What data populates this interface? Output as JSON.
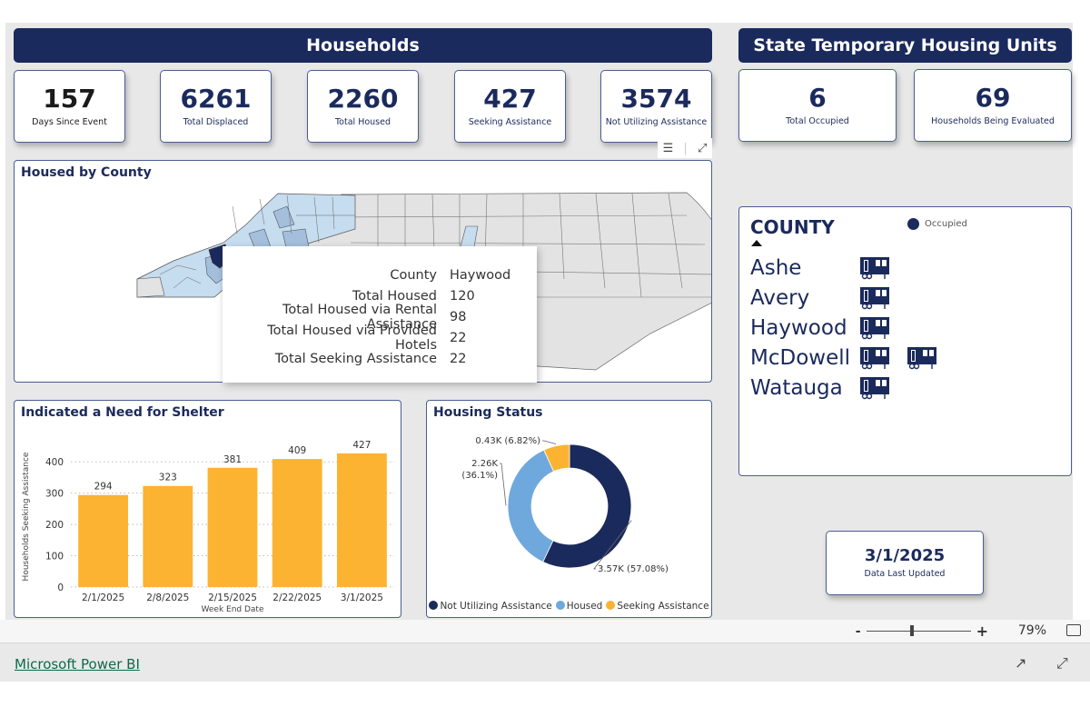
{
  "banners": {
    "households": "Households",
    "temp_housing": "State Temporary Housing Units"
  },
  "kpis": [
    {
      "value": "157",
      "label": "Days Since Event"
    },
    {
      "value": "6261",
      "label": "Total Displaced"
    },
    {
      "value": "2260",
      "label": "Total Housed"
    },
    {
      "value": "427",
      "label": "Seeking Assistance"
    },
    {
      "value": "3574",
      "label": "Not Utilizing Assistance"
    }
  ],
  "temp_kpis": [
    {
      "value": "6",
      "label": "Total Occupied"
    },
    {
      "value": "69",
      "label": "Households Being Evaluated"
    }
  ],
  "visual_toolbar": {
    "filter_icon": "filter-icon",
    "focus_icon": "focus-mode-icon"
  },
  "map": {
    "title": "Housed by County",
    "colors": {
      "none": "#e3e3e3",
      "low": "#c6dcef",
      "mid": "#a3bfdc",
      "high": "#1b2a5c"
    },
    "tooltip": [
      {
        "key": "County",
        "value": "Haywood"
      },
      {
        "key": "Total Housed",
        "value": "120"
      },
      {
        "key": "Total Housed via Rental Assistance",
        "value": "98"
      },
      {
        "key": "Total Housed via Provided Hotels",
        "value": "22"
      },
      {
        "key": "Total Seeking Assistance",
        "value": "22"
      }
    ]
  },
  "shelter_chart": {
    "title": "Indicated a Need for Shelter"
  },
  "housing_chart": {
    "title": "Housing Status"
  },
  "chart_data": [
    {
      "type": "bar",
      "title": "Indicated a Need for Shelter",
      "categories": [
        "2/1/2025",
        "2/8/2025",
        "2/15/2025",
        "2/22/2025",
        "3/1/2025"
      ],
      "values": [
        294,
        323,
        381,
        409,
        427
      ],
      "xlabel": "Week End Date",
      "ylabel": "Households Seeking Assistance",
      "ylim": [
        0,
        450
      ],
      "yticks": [
        0,
        100,
        200,
        300,
        400
      ],
      "grid": true,
      "color": "#fbb331"
    },
    {
      "type": "pie",
      "title": "Housing Status",
      "donut": true,
      "categories": [
        "Not Utilizing Assistance",
        "Housed",
        "Seeking Assistance"
      ],
      "values": [
        3574,
        2260,
        427
      ],
      "labels": [
        "3.57K (57.08%)",
        "2.26K (36.1%)",
        "0.43K (6.82%)"
      ],
      "colors": [
        "#1b2a5c",
        "#6fa8dc",
        "#fbb331"
      ],
      "legend": "bottom"
    }
  ],
  "county_units": {
    "header": "COUNTY",
    "legend_label": "Occupied",
    "legend_color": "#1b2a5c",
    "rows": [
      {
        "county": "Ashe",
        "units": 1
      },
      {
        "county": "Avery",
        "units": 1
      },
      {
        "county": "Haywood",
        "units": 1
      },
      {
        "county": "McDowell",
        "units": 2
      },
      {
        "county": "Watauga",
        "units": 1
      }
    ]
  },
  "last_updated": {
    "value": "3/1/2025",
    "label": "Data Last Updated"
  },
  "statusbar": {
    "zoom_minus": "-",
    "zoom_plus": "+",
    "zoom_percent": "79%",
    "zoom_level": 0.79
  },
  "footer": {
    "link": "Microsoft Power BI"
  }
}
